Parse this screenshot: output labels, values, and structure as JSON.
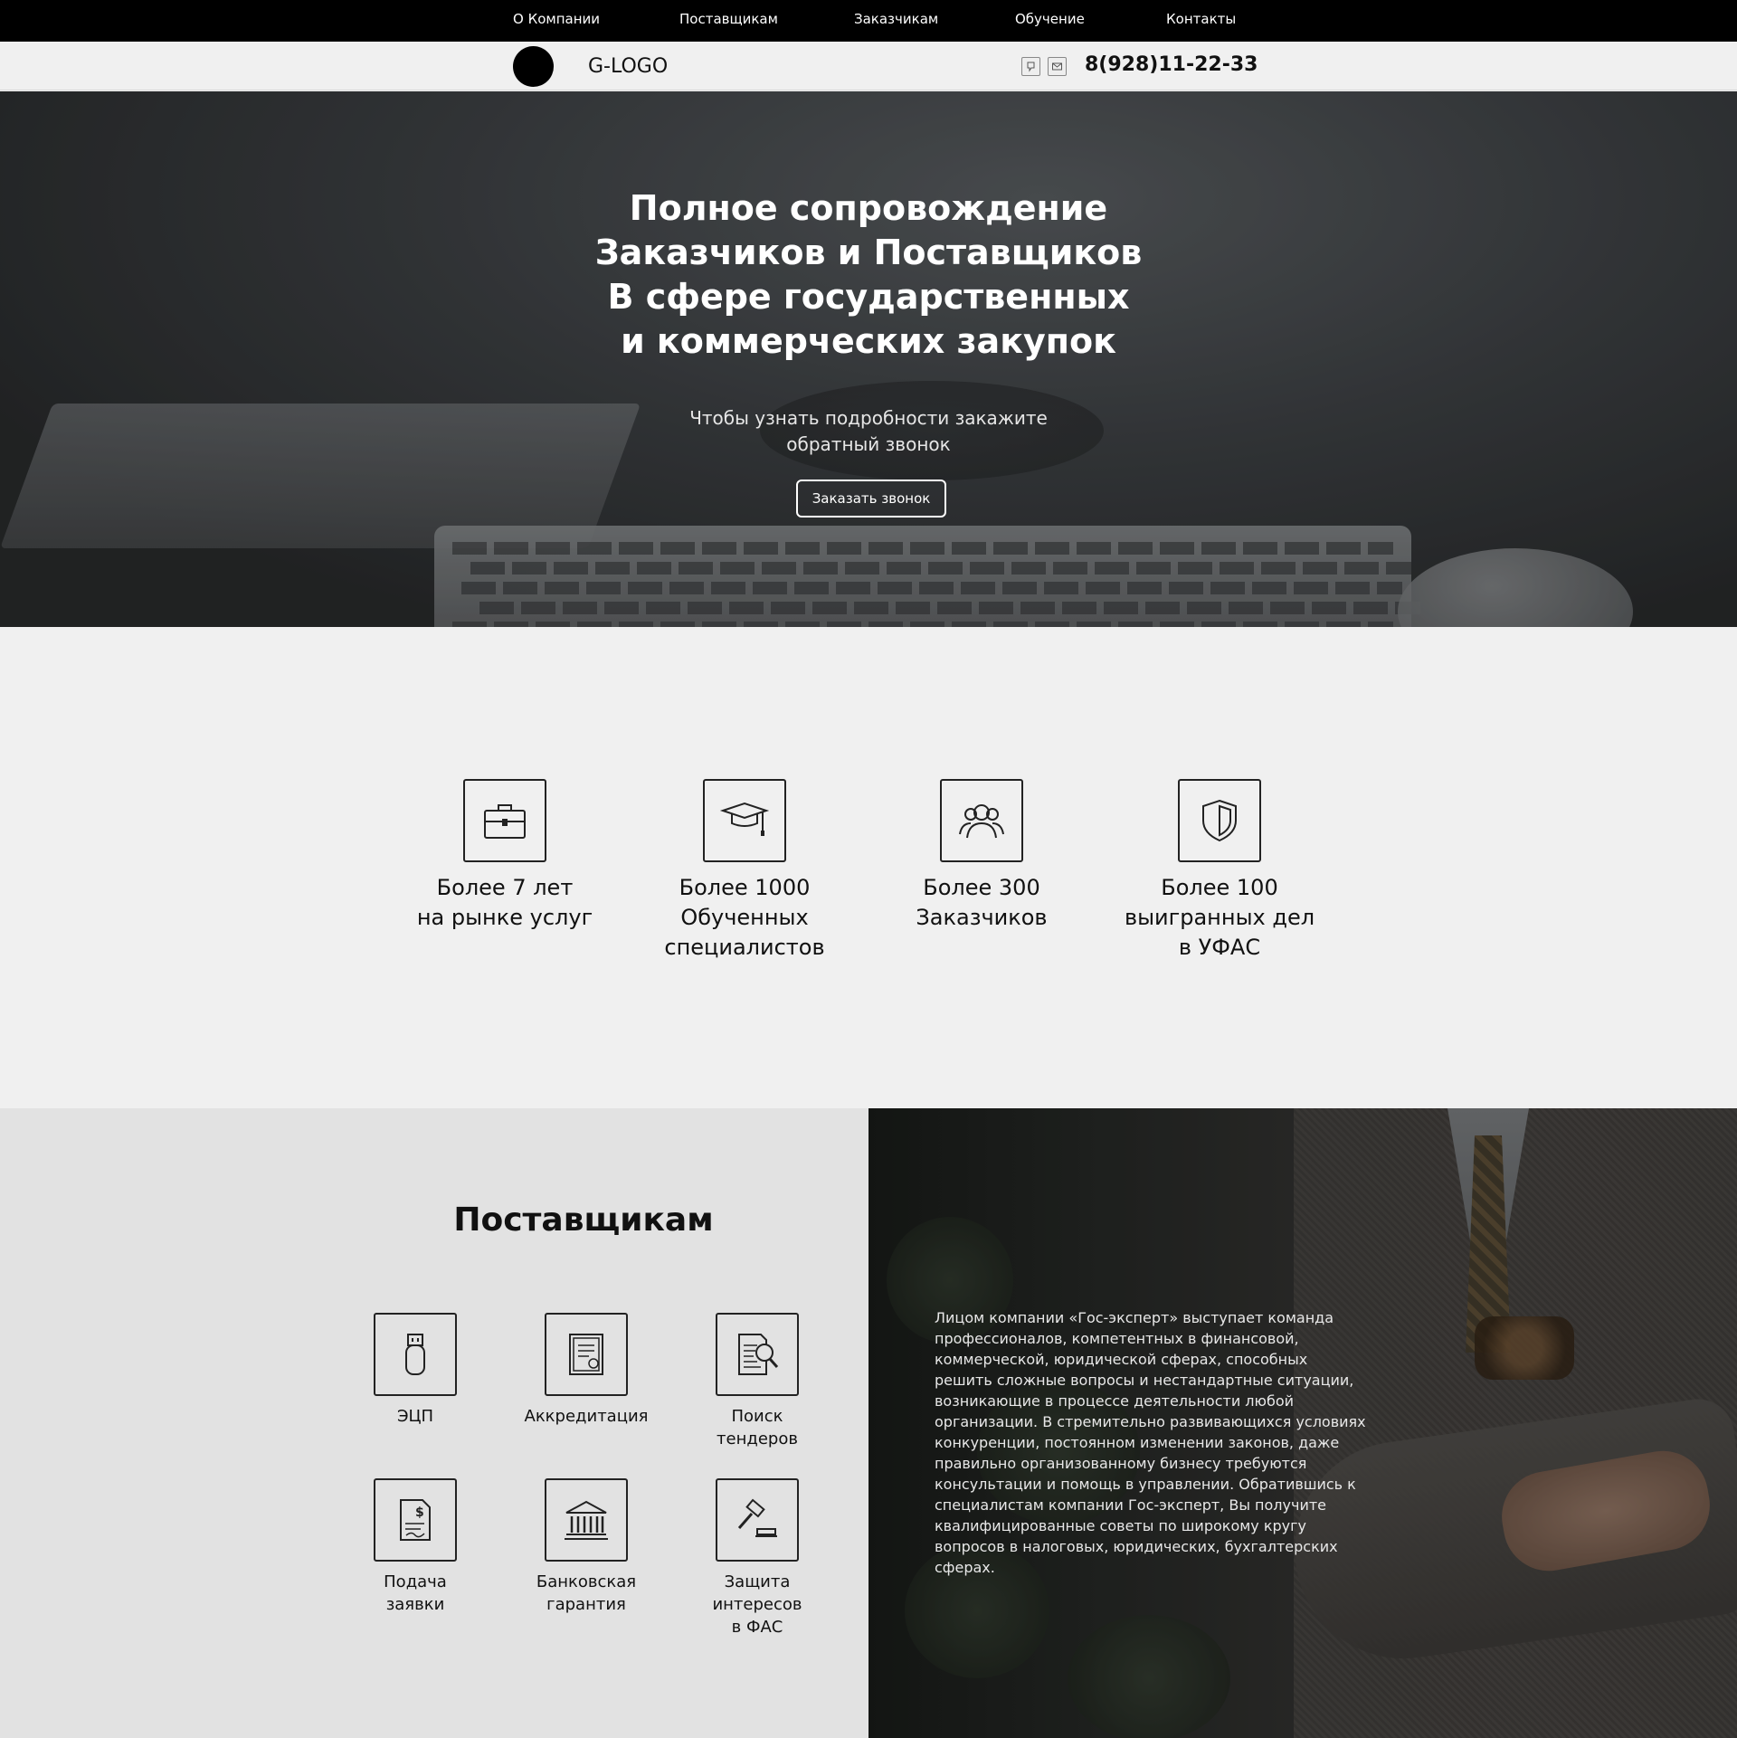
{
  "nav": {
    "items": [
      "О Компании",
      "Поставщикам",
      "Заказчикам",
      "Обучение",
      "Контакты"
    ]
  },
  "header": {
    "logo_text": "G-LOGO",
    "phone": "8(928)11-22-33"
  },
  "hero": {
    "title_lines": [
      "Полное сопровождение",
      "Заказчиков и Поставщиков",
      "В сфере государственных",
      "и коммерческих закупок"
    ],
    "subtitle_lines": [
      "Чтобы узнать подробности закажите",
      "обратный звонок"
    ],
    "button_label": "Заказать звонок"
  },
  "stats": [
    {
      "icon": "briefcase-icon",
      "lines": [
        "Более 7 лет",
        "на рынке услуг"
      ]
    },
    {
      "icon": "graduation-cap-icon",
      "lines": [
        "Более 1000",
        "Обученных",
        "специалистов"
      ]
    },
    {
      "icon": "customers-icon",
      "lines": [
        "Более 300",
        "Заказчиков"
      ]
    },
    {
      "icon": "shield-icon",
      "lines": [
        "Более 100",
        "выигранных дел",
        "в УФАС"
      ]
    }
  ],
  "suppliers": {
    "title": "Поставщикам",
    "services": [
      {
        "icon": "usb-token-icon",
        "lines": [
          "ЭЦП"
        ]
      },
      {
        "icon": "certificate-icon",
        "lines": [
          "Аккредитация"
        ]
      },
      {
        "icon": "document-search-icon",
        "lines": [
          "Поиск",
          "тендеров"
        ]
      },
      {
        "icon": "invoice-icon",
        "lines": [
          "Подача",
          "заявки"
        ]
      },
      {
        "icon": "bank-icon",
        "lines": [
          "Банковская",
          "гарантия"
        ]
      },
      {
        "icon": "gavel-icon",
        "lines": [
          "Защита",
          "интересов",
          "в ФАС"
        ]
      }
    ]
  },
  "about": {
    "text": "Лицом компании «Гос-эксперт» выступает команда профессионалов, компетентных в финансовой, коммерческой, юридической сферах, способных решить сложные вопросы и нестандартные ситуации, возникающие в процессе деятельности любой организации. В стремительно развивающихся условиях конкуренции, постоянном изменении законов, даже правильно организованному бизнесу требуются консультации и помощь в управлении. Обратившись к специалистам компании Гос-эксперт, Вы получите квалифицированные советы по широкому кругу вопросов в налоговых, юридических, бухгалтерских сферах."
  },
  "colors": {
    "nav_bg": "#000000",
    "page_bg": "#f0f0f0",
    "suppliers_bg": "#e2e2e2",
    "text": "#111111"
  }
}
